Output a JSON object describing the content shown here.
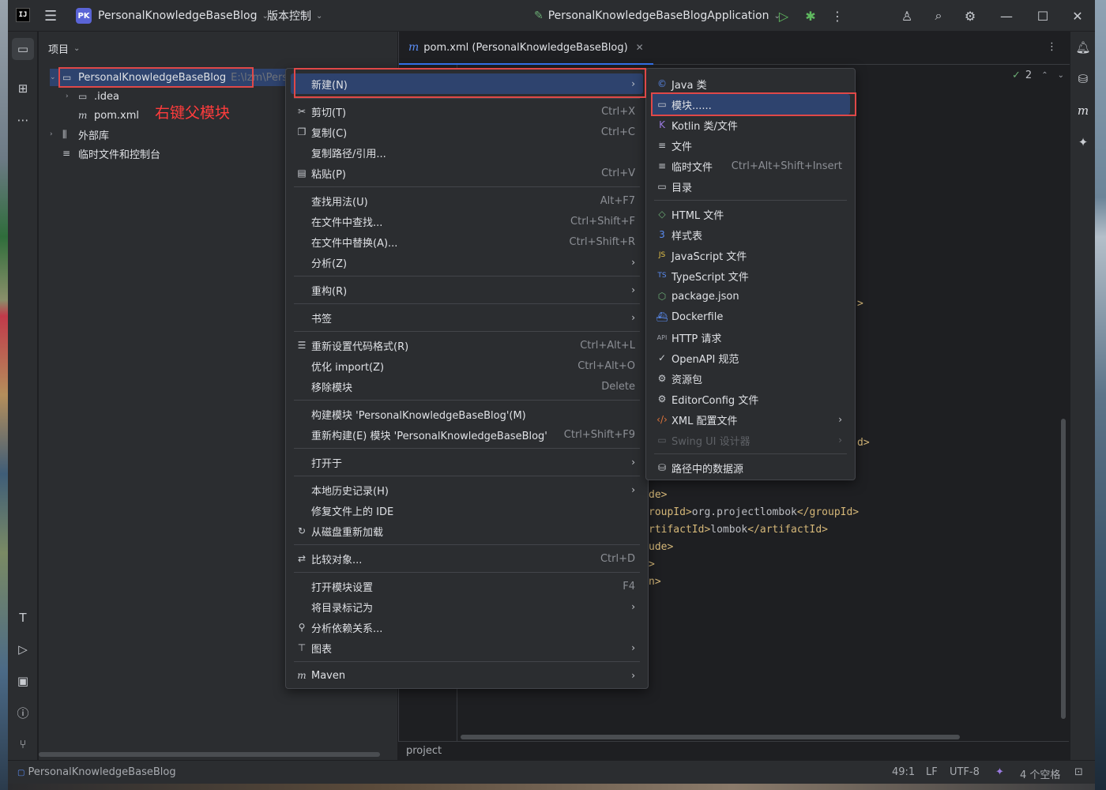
{
  "titlebar": {
    "app_icon": "IJ",
    "project_badge": "PK",
    "project_name": "PersonalKnowledgeBaseBlog",
    "vcs": "版本控制",
    "run_config": "PersonalKnowledgeBaseBlogApplication"
  },
  "project_panel": {
    "title": "项目",
    "root_label": "PersonalKnowledgeBaseBlog",
    "root_path": "E:\\lzm\\Pers",
    "idea": ".idea",
    "pom": "pom.xml",
    "external_libs": "外部库",
    "scratches": "临时文件和控制台",
    "annotation": "右键父模块"
  },
  "editor": {
    "tab_label": "pom.xml (PersonalKnowledgeBaseBlog)",
    "inspection_count": "2",
    "code": {
      "l1": ">",
      "l2": "d>",
      "l3_tag": "de>",
      "l4_pre": "roupId>",
      "l4_val": "org.projectlombok",
      "l4_post": "</groupId>",
      "l5_pre": "rtifactId>",
      "l5_val": "lombok",
      "l5_post": "</artifactId>",
      "l6": "ude>",
      "l7": ">",
      "l8": "n>"
    },
    "breadcrumb": "project"
  },
  "statusbar": {
    "path": "PersonalKnowledgeBaseBlog",
    "position": "49:1",
    "line_sep": "LF",
    "encoding": "UTF-8",
    "indent": "4 个空格"
  },
  "context_menu": {
    "new": "新建(N)",
    "cut": "剪切(T)",
    "cut_sc": "Ctrl+X",
    "copy": "复制(C)",
    "copy_sc": "Ctrl+C",
    "copy_path": "复制路径/引用...",
    "paste": "粘贴(P)",
    "paste_sc": "Ctrl+V",
    "find_usages": "查找用法(U)",
    "find_usages_sc": "Alt+F7",
    "find_in_files": "在文件中查找...",
    "find_in_files_sc": "Ctrl+Shift+F",
    "replace_in_files": "在文件中替换(A)...",
    "replace_in_files_sc": "Ctrl+Shift+R",
    "analyze": "分析(Z)",
    "refactor": "重构(R)",
    "bookmarks": "书签",
    "reformat": "重新设置代码格式(R)",
    "reformat_sc": "Ctrl+Alt+L",
    "optimize_imports": "优化 import(Z)",
    "optimize_imports_sc": "Ctrl+Alt+O",
    "remove_module": "移除模块",
    "remove_module_sc": "Delete",
    "build_module": "构建模块 'PersonalKnowledgeBaseBlog'(M)",
    "rebuild_module": "重新构建(E) 模块 'PersonalKnowledgeBaseBlog'",
    "rebuild_module_sc": "Ctrl+Shift+F9",
    "open_in": "打开于",
    "local_history": "本地历史记录(H)",
    "repair_ide": "修复文件上的 IDE",
    "reload": "从磁盘重新加载",
    "compare": "比较对象...",
    "compare_sc": "Ctrl+D",
    "module_settings": "打开模块设置",
    "module_settings_sc": "F4",
    "mark_dir": "将目录标记为",
    "analyze_deps": "分析依赖关系...",
    "diagrams": "图表",
    "maven": "Maven"
  },
  "submenu": {
    "java_class": "Java 类",
    "module": "模块......",
    "kotlin": "Kotlin 类/文件",
    "file": "文件",
    "scratch": "临时文件",
    "scratch_sc": "Ctrl+Alt+Shift+Insert",
    "directory": "目录",
    "html": "HTML 文件",
    "stylesheet": "样式表",
    "javascript": "JavaScript 文件",
    "typescript": "TypeScript 文件",
    "package_json": "package.json",
    "dockerfile": "Dockerfile",
    "http": "HTTP 请求",
    "openapi": "OpenAPI 规范",
    "resource_bundle": "资源包",
    "editorconfig": "EditorConfig 文件",
    "xml_config": "XML 配置文件",
    "swing": "Swing UI 设计器",
    "datasource": "路径中的数据源"
  },
  "colors": {
    "background": "#1e1f22",
    "panel": "#2b2d30",
    "selection": "#2e436e",
    "highlight_box": "#e04848",
    "annotation_text": "#ff3c3c",
    "xml_tag": "#d5b778"
  }
}
